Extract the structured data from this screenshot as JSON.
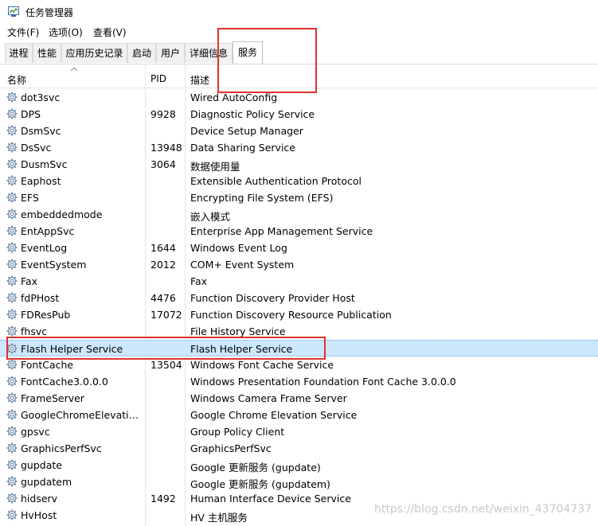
{
  "window": {
    "title": "任务管理器"
  },
  "menu": [
    "文件(F)",
    "选项(O)",
    "查看(V)"
  ],
  "tabs": [
    "进程",
    "性能",
    "应用历史记录",
    "启动",
    "用户",
    "详细信息",
    "服务"
  ],
  "active_tab": "服务",
  "columns": {
    "name": "名称",
    "pid": "PID",
    "desc": "描述"
  },
  "rows": [
    {
      "name": "dot3svc",
      "pid": "",
      "desc": "Wired AutoConfig"
    },
    {
      "name": "DPS",
      "pid": "9928",
      "desc": "Diagnostic Policy Service"
    },
    {
      "name": "DsmSvc",
      "pid": "",
      "desc": "Device Setup Manager"
    },
    {
      "name": "DsSvc",
      "pid": "13948",
      "desc": "Data Sharing Service"
    },
    {
      "name": "DusmSvc",
      "pid": "3064",
      "desc": "数据使用量"
    },
    {
      "name": "Eaphost",
      "pid": "",
      "desc": "Extensible Authentication Protocol"
    },
    {
      "name": "EFS",
      "pid": "",
      "desc": "Encrypting File System (EFS)"
    },
    {
      "name": "embeddedmode",
      "pid": "",
      "desc": "嵌入模式"
    },
    {
      "name": "EntAppSvc",
      "pid": "",
      "desc": "Enterprise App Management Service"
    },
    {
      "name": "EventLog",
      "pid": "1644",
      "desc": "Windows Event Log"
    },
    {
      "name": "EventSystem",
      "pid": "2012",
      "desc": "COM+ Event System"
    },
    {
      "name": "Fax",
      "pid": "",
      "desc": "Fax"
    },
    {
      "name": "fdPHost",
      "pid": "4476",
      "desc": "Function Discovery Provider Host"
    },
    {
      "name": "FDResPub",
      "pid": "17072",
      "desc": "Function Discovery Resource Publication"
    },
    {
      "name": "fhsvc",
      "pid": "",
      "desc": "File History Service"
    },
    {
      "name": "Flash Helper Service",
      "pid": "",
      "desc": "Flash Helper Service",
      "selected": true
    },
    {
      "name": "FontCache",
      "pid": "13504",
      "desc": "Windows Font Cache Service"
    },
    {
      "name": "FontCache3.0.0.0",
      "pid": "",
      "desc": "Windows Presentation Foundation Font Cache 3.0.0.0"
    },
    {
      "name": "FrameServer",
      "pid": "",
      "desc": "Windows Camera Frame Server"
    },
    {
      "name": "GoogleChromeElevation...",
      "pid": "",
      "desc": "Google Chrome Elevation Service"
    },
    {
      "name": "gpsvc",
      "pid": "",
      "desc": "Group Policy Client"
    },
    {
      "name": "GraphicsPerfSvc",
      "pid": "",
      "desc": "GraphicsPerfSvc"
    },
    {
      "name": "gupdate",
      "pid": "",
      "desc": "Google 更新服务 (gupdate)"
    },
    {
      "name": "gupdatem",
      "pid": "",
      "desc": "Google 更新服务 (gupdatem)"
    },
    {
      "name": "hidserv",
      "pid": "1492",
      "desc": "Human Interface Device Service"
    },
    {
      "name": "HvHost",
      "pid": "",
      "desc": "HV 主机服务"
    }
  ],
  "watermark": "https://blog.csdn.net/weixin_43704737",
  "colors": {
    "selection": "#cce8ff",
    "annotation": "#e0322f"
  }
}
